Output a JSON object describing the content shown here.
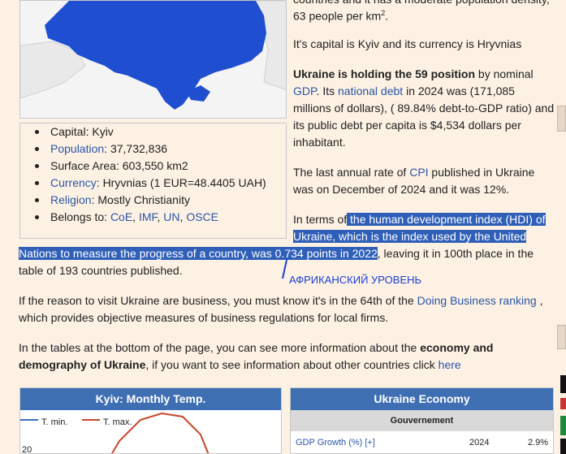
{
  "intro": {
    "line_a": "countries and it has a moderate population density,",
    "line_b": "63 people per km",
    "line_b_sup": "2",
    "line_b_end": "."
  },
  "capital_para": "It's capital is Kyiv and its currency is Hryvnias",
  "gdp_para": {
    "bold": "Ukraine is holding the 59 position",
    "t1": " by nominal",
    "link_gdp": "GDP",
    "t2": ". Its ",
    "link_debt": "national debt",
    "t3": " in 2024 was (171,085",
    "l3": "millions of dollars), ( 89.84% debt-to-GDP ratio) and",
    "l4": "its public debt per capita is $4,534 dollars per",
    "l5": "inhabitant."
  },
  "cpi_para": {
    "t1": "The last annual rate of ",
    "link_cpi": "CPI",
    "t2": " published in Ukraine",
    "l2": "was on December of 2024 and it was 12%."
  },
  "hdi_para": {
    "l1_pre": "In terms of",
    "l1_hl": " the human development index (HDI) of",
    "l2_hl": "Ukraine, which is the index used by the United",
    "l3_hl": "Nations to measure the progress of a country, was 0.734 points in 2022",
    "l3_post": ", leaving it in 100th place in the",
    "l4": "table of 193 countries published."
  },
  "annotation_text": "АФРИКАНСКИЙ УРОВЕНЬ",
  "business_para": {
    "t1": "If the reason to visit Ukraine are business, you must know it's in the 64th of the ",
    "link": "Doing Business ranking",
    "t2": " ,",
    "l2": "which provides objective measures of business regulations for local firms."
  },
  "tables_para": {
    "t1": "In the tables at the bottom of the page, you can see more information about the ",
    "b1": "economy and",
    "b2": "demography of Ukraine",
    "t2": ", if you want to see information about other countries click ",
    "link": "here"
  },
  "facts": [
    {
      "label": "",
      "label_link": "",
      "text": "Capital: Kyiv"
    },
    {
      "label_link": "Population",
      "text": ": 37,732,836"
    },
    {
      "label": "",
      "label_link": "",
      "text": "Surface Area: 603,550 km2"
    },
    {
      "label_link": "Currency",
      "text": ": Hryvnias (1 EUR=48.4405 UAH)"
    },
    {
      "label_link": "Religion",
      "text": ": Mostly Christianity"
    },
    {
      "text": "Belongs to: ",
      "links": [
        "CoE",
        "IMF",
        "UN",
        "OSCE"
      ]
    }
  ],
  "temp_panel": {
    "title": "Kyiv: Monthly Temp.",
    "legend_min": "T. min.",
    "legend_max": "T. max.",
    "y_tick": "20"
  },
  "econ_panel": {
    "title": "Ukraine Economy",
    "subheader": "Gouvernement",
    "row_label": "GDP Growth (%) [+]",
    "row_year": "2024",
    "row_value": "2.9%"
  },
  "colors": {
    "background": "#fdf1e3",
    "link": "#2b56a8",
    "highlight": "#2f5fb8",
    "map_ukraine": "#1f4fd0",
    "panel_header": "#3f6fb3",
    "tmax_line": "#c8462a",
    "tmin_line": "#3d6fc4"
  }
}
